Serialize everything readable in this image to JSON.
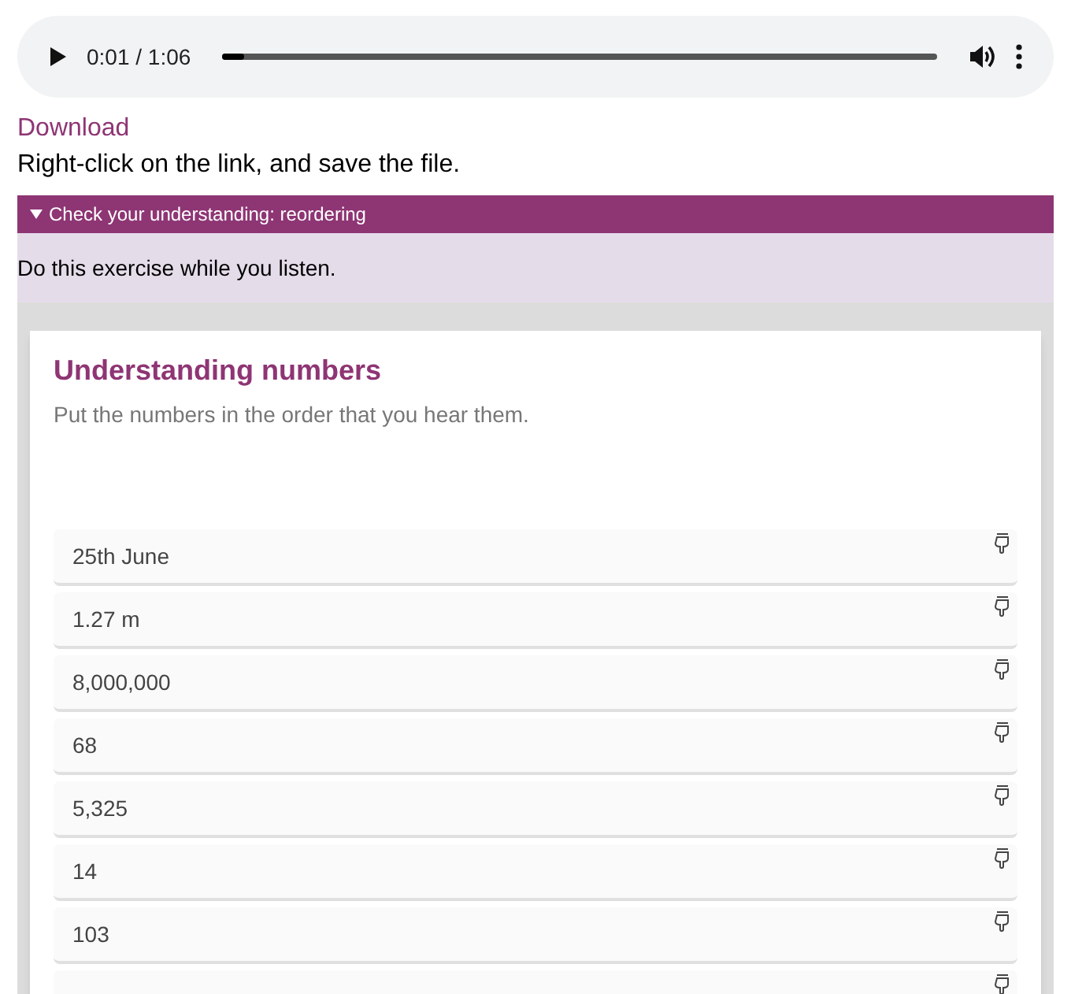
{
  "audio_player": {
    "time": "0:01 / 1:06",
    "level": 0.03
  },
  "download_link": "Download",
  "download_hint": "Right-click on the link, and save the file.",
  "section": {
    "title": "Check your understanding: reordering",
    "expanded": true,
    "instruction": "Do this exercise while you listen."
  },
  "exercise": {
    "title": "Understanding numbers",
    "prompt": "Put the numbers in the order that you hear them.",
    "items": [
      {
        "text": "25th June"
      },
      {
        "text": "1.27 m"
      },
      {
        "text": "8,000,000"
      },
      {
        "text": "68"
      },
      {
        "text": "5,325"
      },
      {
        "text": "14"
      },
      {
        "text": "103"
      }
    ],
    "more_items_below": true
  }
}
